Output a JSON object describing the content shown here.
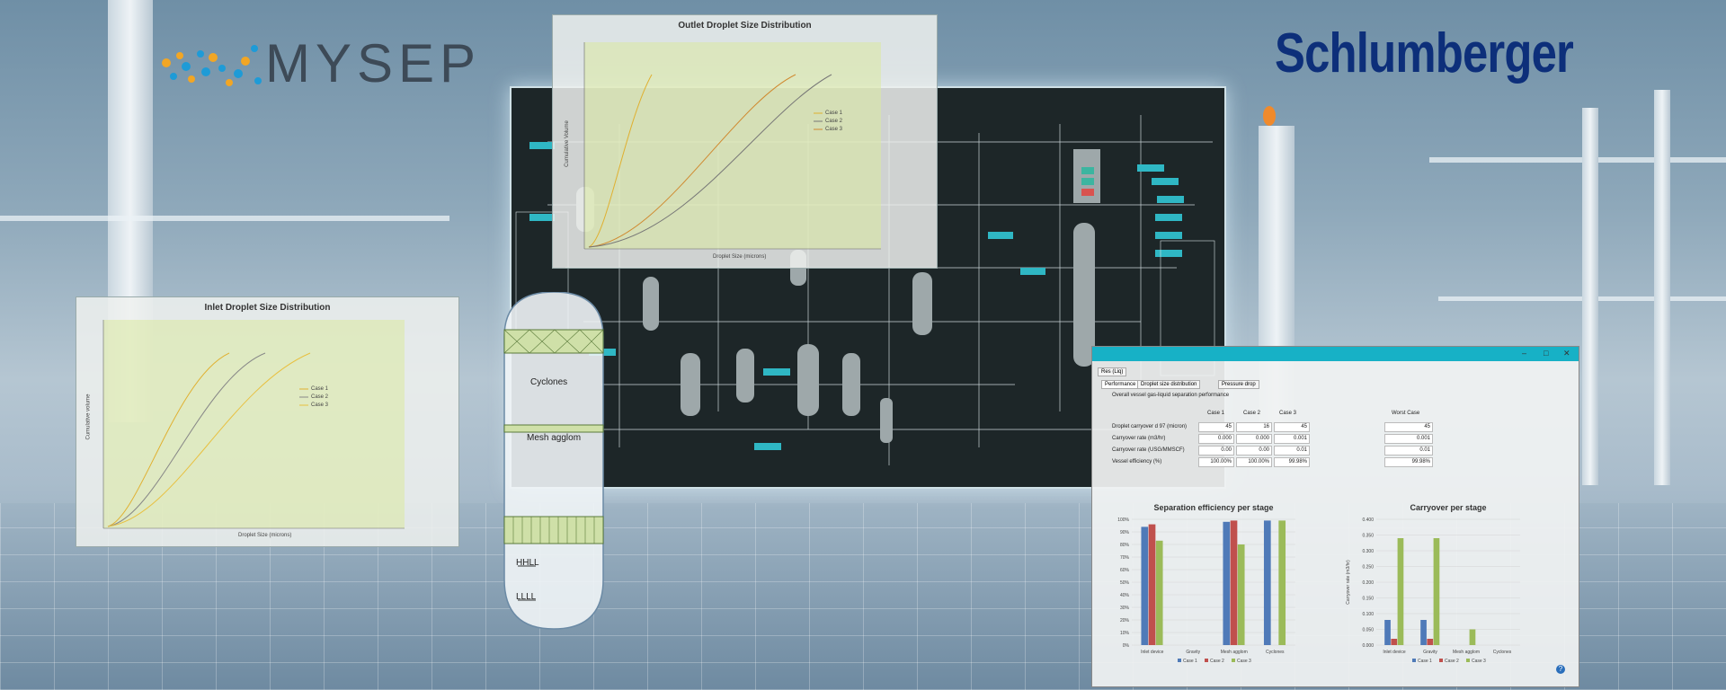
{
  "logos": {
    "mysep": "MYSEP",
    "schlumberger": "Schlumberger"
  },
  "outlet_chart": {
    "title": "Outlet Droplet Size Distribution",
    "xlabel": "Droplet Size (microns)",
    "ylabel": "Cumulative Volume",
    "legend": [
      "Case 1",
      "Case 2",
      "Case 3"
    ]
  },
  "inlet_chart": {
    "title": "Inlet Droplet Size Distribution",
    "xlabel": "Droplet Size (microns)",
    "ylabel": "Cumulative volume",
    "legend": [
      "Case 1",
      "Case 2",
      "Case 3"
    ]
  },
  "vessel": {
    "cyclones_label": "Cyclones",
    "mesh_label": "Mesh agglom",
    "hhll_label": "HHLL",
    "lll_label": "LLLL"
  },
  "results_window": {
    "tab_main": "Res (Liq)",
    "subtabs": [
      "Performance",
      "Droplet size distribution",
      "Pressure drop"
    ],
    "section_title": "Overall vessel gas-liquid separation performance",
    "columns": [
      "Case 1",
      "Case 2",
      "Case 3"
    ],
    "worst_case_header": "Worst Case",
    "rows": [
      {
        "label": "Droplet carryover d 97 (micron)",
        "values": [
          "45",
          "16",
          "45"
        ],
        "worst": "45"
      },
      {
        "label": "Carryover rate (m3/hr)",
        "values": [
          "0.000",
          "0.000",
          "0.001"
        ],
        "worst": "0.001"
      },
      {
        "label": "Carryover rate (USG/MMSCF)",
        "values": [
          "0.00",
          "0.00",
          "0.01"
        ],
        "worst": "0.01"
      },
      {
        "label": "Vessel efficiency (%)",
        "values": [
          "100.00%",
          "100.00%",
          "99.98%"
        ],
        "worst": "99.98%"
      }
    ]
  },
  "charts_colors": {
    "case1": "#4f7ab8",
    "case2": "#c0504d",
    "case3": "#9bbb59"
  },
  "chart_data": [
    {
      "type": "bar",
      "title": "Separation efficiency per stage",
      "categories": [
        "Inlet device",
        "Gravity",
        "Mesh agglom",
        "Cyclones"
      ],
      "series": [
        {
          "name": "Case 1",
          "values": [
            94,
            0,
            98,
            99
          ]
        },
        {
          "name": "Case 2",
          "values": [
            96,
            0,
            99,
            0
          ]
        },
        {
          "name": "Case 3",
          "values": [
            83,
            0,
            80,
            99
          ]
        }
      ],
      "yticks": [
        "0%",
        "10%",
        "20%",
        "30%",
        "40%",
        "50%",
        "60%",
        "70%",
        "80%",
        "90%",
        "100%"
      ],
      "ylim": [
        0,
        100
      ],
      "legend_position": "bottom"
    },
    {
      "type": "bar",
      "title": "Carryover per stage",
      "ylabel": "Carryover rate (m3/hr)",
      "categories": [
        "Inlet device",
        "Gravity",
        "Mesh agglom",
        "Cyclones"
      ],
      "series": [
        {
          "name": "Case 1",
          "values": [
            0.08,
            0.08,
            0,
            0
          ]
        },
        {
          "name": "Case 2",
          "values": [
            0.02,
            0.02,
            0,
            0
          ]
        },
        {
          "name": "Case 3",
          "values": [
            0.34,
            0.34,
            0.05,
            0
          ]
        }
      ],
      "yticks": [
        "0.000",
        "0.050",
        "0.100",
        "0.150",
        "0.200",
        "0.250",
        "0.300",
        "0.350",
        "0.400"
      ],
      "ylim": [
        0,
        0.4
      ],
      "legend_position": "bottom"
    }
  ]
}
